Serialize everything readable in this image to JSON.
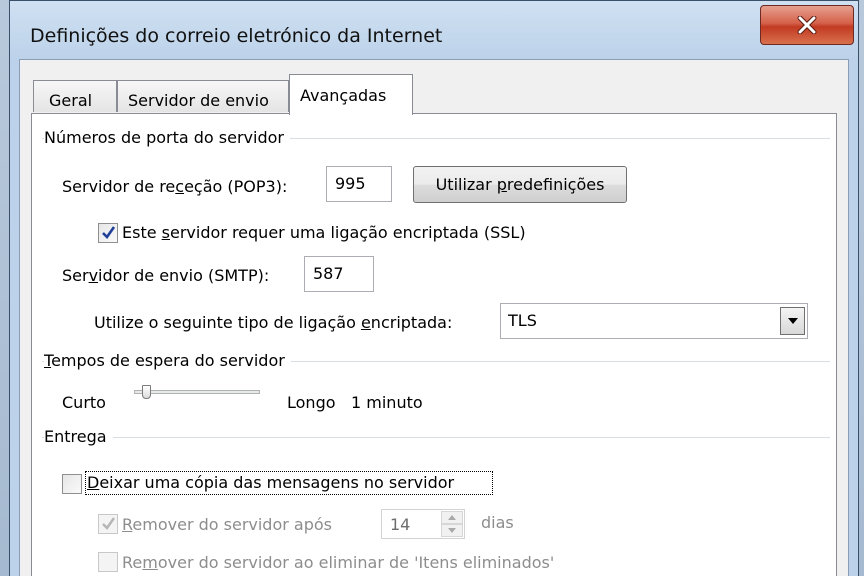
{
  "window": {
    "title": "Definições do correio eletrónico da Internet",
    "close_icon": "close-icon"
  },
  "tabs": [
    {
      "label": "Geral",
      "active": false
    },
    {
      "label": "Servidor de envio",
      "active": false
    },
    {
      "label": "Avançadas",
      "active": true
    }
  ],
  "ports": {
    "group_label": "Números de porta do servidor",
    "incoming_pre": "Servidor de re",
    "incoming_key": "c",
    "incoming_post": "eção (POP3):",
    "incoming_value": "995",
    "defaults_pre": "Utilizar ",
    "defaults_key": "p",
    "defaults_post": "redefinições",
    "ssl_pre": "Este ",
    "ssl_key": "s",
    "ssl_post": "ervidor requer uma ligação encriptada (SSL)",
    "ssl_checked": true,
    "outgoing_pre": "Ser",
    "outgoing_key": "v",
    "outgoing_post": "idor de envio (SMTP):",
    "outgoing_value": "587",
    "encryption_pre": "Utilize o seguinte tipo de ligação ",
    "encryption_key": "e",
    "encryption_post": "ncriptada:",
    "encryption_value": "TLS"
  },
  "timeouts": {
    "group_key": "T",
    "group_rest": "empos de espera do servidor",
    "short_label": "Curto",
    "long_label": "Longo",
    "value_text": "1 minuto",
    "slider_fraction": 0.07
  },
  "delivery": {
    "group_label": "Entrega",
    "leave_copy_key": "D",
    "leave_copy_rest": "eixar uma cópia das mensagens no servidor",
    "leave_copy_checked": false,
    "remove_after_key": "R",
    "remove_after_rest": "emover do servidor após",
    "remove_after_checked": true,
    "remove_after_days": "14",
    "days_label": "dias",
    "remove_deleted_pre": "Re",
    "remove_deleted_key": "m",
    "remove_deleted_post": "over do servidor ao eliminar de 'Itens eliminados'",
    "remove_deleted_checked": false
  }
}
